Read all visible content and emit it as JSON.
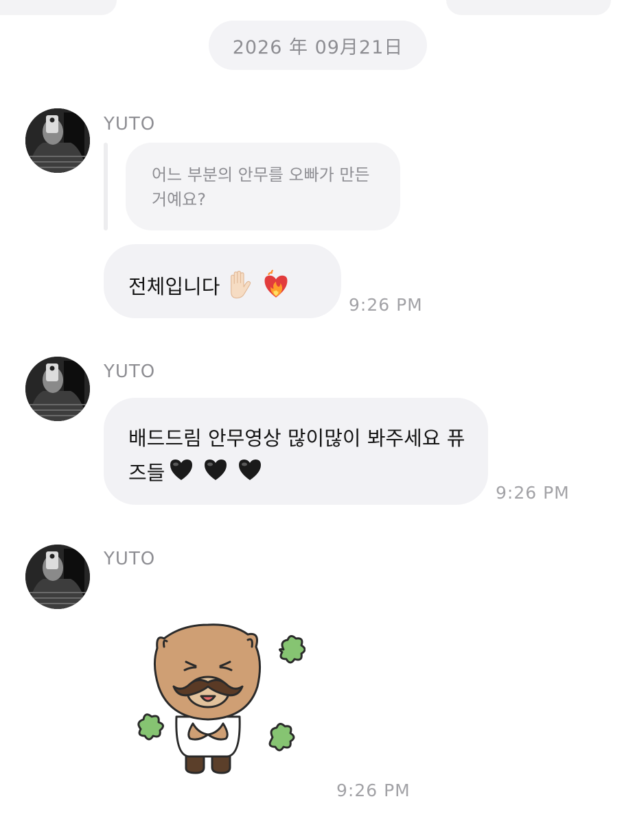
{
  "date_separator": "2026 年 09月21日",
  "messages": [
    {
      "sender": "YUTO",
      "quoted_text": "어느 부분의 안무를 오빠가 만든 거예요?",
      "text": "전체입니다",
      "emojis": [
        "raised-hand-emoji",
        "heart-on-fire-emoji"
      ],
      "time": "9:26 PM"
    },
    {
      "sender": "YUTO",
      "text": "배드드림 안무영상 많이많이 봐주세요 퓨즈들",
      "emojis": [
        "black-heart-emoji",
        "black-heart-emoji",
        "black-heart-emoji"
      ],
      "time": "9:26 PM"
    },
    {
      "sender": "YUTO",
      "sticker": "bear-with-mustache-sticker",
      "time": "9:26 PM"
    }
  ],
  "colors": {
    "bubble_bg": "#f2f2f5",
    "meta_text": "#8e8e93",
    "time_text": "#a2a2a6",
    "sticker_bear": "#cf9f74",
    "sticker_clover": "#86c472"
  }
}
